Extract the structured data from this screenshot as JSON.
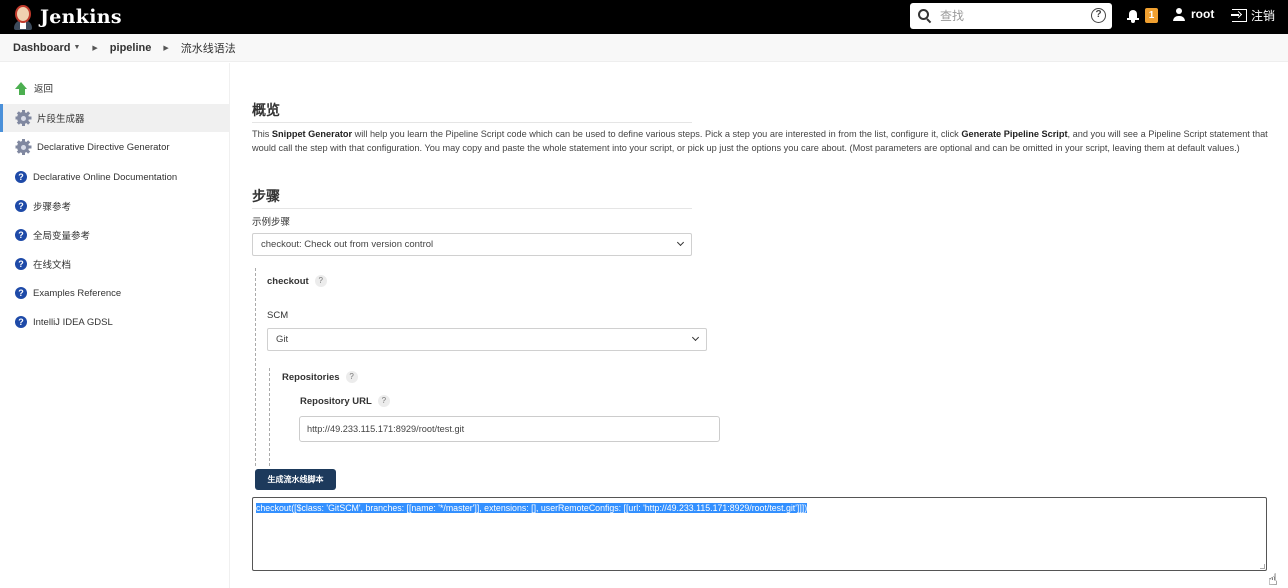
{
  "header": {
    "app_name": "Jenkins",
    "search_placeholder": "查找",
    "search_value": "",
    "help_icon": "?",
    "notification_count": "1",
    "username": "root",
    "logout_label": "注销"
  },
  "breadcrumb": {
    "items": [
      "Dashboard",
      "pipeline",
      "流水线语法"
    ]
  },
  "sidebar": {
    "items": [
      {
        "label": "返回",
        "icon": "up-arrow-icon",
        "active": false
      },
      {
        "label": "片段生成器",
        "icon": "gear-icon",
        "active": true
      },
      {
        "label": "Declarative Directive Generator",
        "icon": "gear-icon",
        "active": false
      },
      {
        "label": "Declarative Online Documentation",
        "icon": "help-icon",
        "active": false
      },
      {
        "label": "步骤参考",
        "icon": "help-icon",
        "active": false
      },
      {
        "label": "全局变量参考",
        "icon": "help-icon",
        "active": false
      },
      {
        "label": "在线文档",
        "icon": "help-icon",
        "active": false
      },
      {
        "label": "Examples Reference",
        "icon": "help-icon",
        "active": false
      },
      {
        "label": "IntelliJ IDEA GDSL",
        "icon": "help-icon",
        "active": false
      }
    ]
  },
  "main": {
    "overview_title": "概览",
    "description": {
      "part1": "This ",
      "bold1": "Snippet Generator",
      "part2": " will help you learn the Pipeline Script code which can be used to define various steps. Pick a step you are interested in from the list, configure it, click ",
      "bold2": "Generate Pipeline Script",
      "part3": ", and you will see a Pipeline Script statement that would call the step with that configuration. You may copy and paste the whole statement into your script, or pick up just the options you care about. (Most parameters are optional and can be omitted in your script, leaving them at default values.)"
    },
    "steps_title": "步骤",
    "sample_step_label": "示例步骤",
    "sample_step_value": "checkout: Check out from version control",
    "checkout_label": "checkout",
    "scm_label": "SCM",
    "scm_value": "Git",
    "repositories_label": "Repositories",
    "repo_url_label": "Repository URL",
    "repo_url_value": "http://49.233.115.171:8929/root/test.git",
    "help_mark": "?",
    "generate_button": "生成流水线脚本",
    "output": "checkout([$class: 'GitSCM', branches: [[name: '*/master']], extensions: [], userRemoteConfigs: [[url: 'http://49.233.115.171:8929/root/test.git']]])"
  },
  "colors": {
    "header_bg": "#000000",
    "badge": "#f0a030",
    "button_bg": "#1d3a5c",
    "help_icon": "#1e4aa8",
    "selection": "#3390ff",
    "active_indicator": "#4a90d9"
  }
}
